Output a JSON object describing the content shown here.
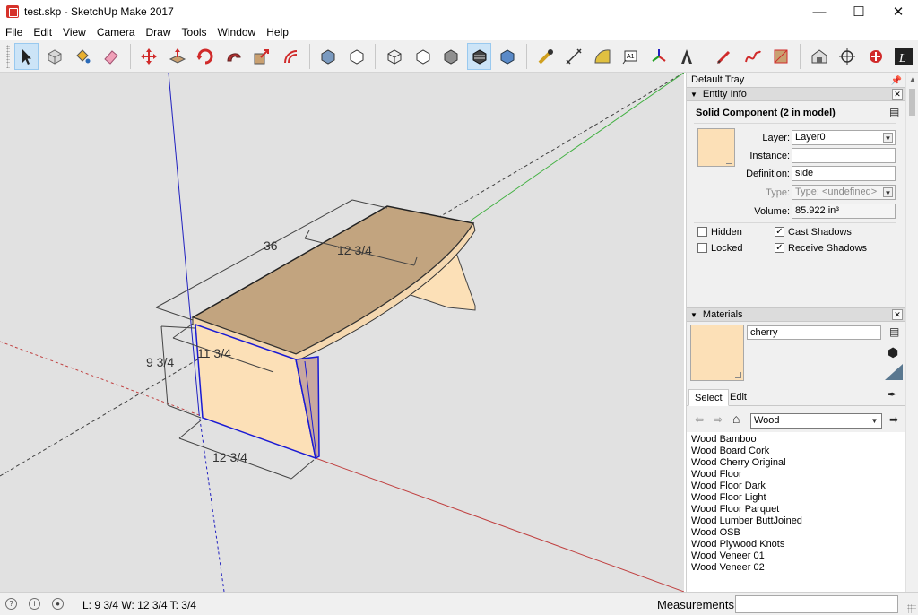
{
  "window": {
    "title": "test.skp - SketchUp Make 2017",
    "minimize": "—",
    "maximize": "☐",
    "close": "✕"
  },
  "menu": [
    "File",
    "Edit",
    "View",
    "Camera",
    "Draw",
    "Tools",
    "Window",
    "Help"
  ],
  "toolbar": {
    "tools": [
      "select-arrow",
      "make-component",
      "paint-bucket",
      "eraser",
      "move",
      "push-pull",
      "rotate",
      "follow-me",
      "scale",
      "offset",
      "iso-view",
      "top-view",
      "xray-style",
      "wireframe-style",
      "hidden-line-style",
      "shaded-style",
      "textured-style",
      "monochrome-style",
      "tape-measure",
      "dimension",
      "protractor",
      "text",
      "axes",
      "3d-text",
      "line",
      "freehand",
      "rectangle",
      "warehouse",
      "position-camera",
      "extension-warehouse",
      "layout"
    ]
  },
  "viewport": {
    "dimensions": {
      "length_top": "36",
      "width_top": "12 3/4",
      "width_side": "11 3/4",
      "height": "9 3/4",
      "width_bottom": "12 3/4"
    },
    "colors": {
      "background": "#e1e1e1",
      "top_face": "#c2a47f",
      "side_face": "#fce0b7",
      "selection": "#1a1ad4",
      "red_axis": "#c03030",
      "green_axis": "#30b030",
      "blue_axis": "#2020c0"
    }
  },
  "tray": {
    "title": "Default Tray",
    "entity_info": {
      "header": "Entity Info",
      "title": "Solid Component (2 in model)",
      "layer_label": "Layer:",
      "layer_value": "Layer0",
      "instance_label": "Instance:",
      "instance_value": "",
      "definition_label": "Definition:",
      "definition_value": "side",
      "type_label": "Type:",
      "type_value": "Type: <undefined>",
      "volume_label": "Volume:",
      "volume_value": "85.922 in³",
      "hidden_label": "Hidden",
      "locked_label": "Locked",
      "cast_shadows_label": "Cast Shadows",
      "receive_shadows_label": "Receive Shadows",
      "hidden": false,
      "locked": false,
      "cast_shadows": true,
      "receive_shadows": true,
      "swatch_color": "#fce0b7"
    },
    "materials": {
      "header": "Materials",
      "material_name": "cherry",
      "tab_select": "Select",
      "tab_edit": "Edit",
      "collection": "Wood",
      "items": [
        "Wood Bamboo",
        "Wood Board Cork",
        "Wood Cherry Original",
        "Wood Floor",
        "Wood Floor Dark",
        "Wood Floor Light",
        "Wood Floor Parquet",
        "Wood Lumber ButtJoined",
        "Wood OSB",
        "Wood Plywood Knots",
        "Wood Veneer 01",
        "Wood Veneer 02"
      ]
    }
  },
  "status": {
    "text": "L: 9 3/4  W: 12 3/4  T: 3/4",
    "measurements_label": "Measurements",
    "measurements_value": ""
  }
}
